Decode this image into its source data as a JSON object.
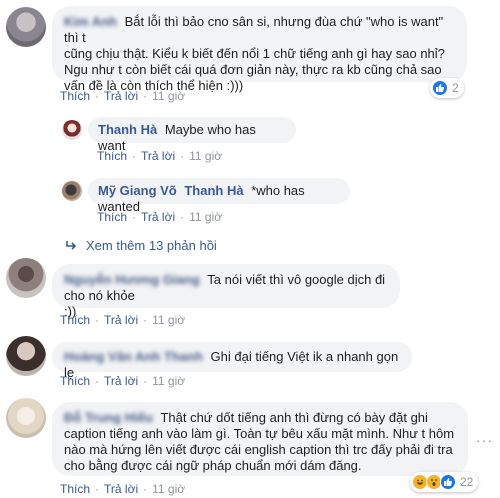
{
  "comments": [
    {
      "author": "Kim Anh",
      "text": "Bắt lỗi thì bảo cno sân si, nhưng đùa chứ \"who is want\" thì t cũng chịu thật. Kiểu k biết đến nổi 1 chữ tiếng anh gì hay sao nhỉ? Ngu như t còn biết cái quá đơn giản này, thực ra kb cũng chả sao vấn đề là còn thích thể hiện :)))",
      "lines": [
        "Bắt lỗi thì bảo cno sân si, nhưng đùa chứ \"who is want\" thì t",
        "cũng chịu thật. Kiểu k biết đến nổi 1 chữ tiếng anh gì hay sao nhỉ?",
        "Ngu như t còn biết cái quá đơn giản này, thực ra kb cũng chả sao",
        "vấn đề là còn thích thể hiện :)))"
      ],
      "like": "Thích",
      "reply": "Trả lời",
      "time": "11 giờ",
      "reaction_count": "2"
    },
    {
      "author": "Thanh Hà",
      "text": "Maybe who has want",
      "like": "Thích",
      "reply": "Trả lời",
      "time": "11 giờ"
    },
    {
      "author": "Mỹ Giang Võ",
      "mention": "Thanh Hà",
      "text": "*who has wanted",
      "like": "Thích",
      "reply": "Trả lời",
      "time": "11 giờ"
    },
    {
      "author": "Nguyễn Hương Giang",
      "lines": [
        "Ta nói viết thì vô google dịch đi cho nó khỏe",
        ":))"
      ],
      "like": "Thích",
      "reply": "Trả lời",
      "time": "11 giờ"
    },
    {
      "author": "Hoàng Văn Anh Thanh",
      "text": "Ghi đại tiếng Việt ik a nhanh gọn lẹ",
      "like": "Thích",
      "reply": "Trả lời",
      "time": "11 giờ"
    },
    {
      "author": "Đỗ Trung Hiếu",
      "lines": [
        "Thật chứ dốt tiếng anh thì đừng có bày đặt ghi",
        "caption tiếng anh vào làm gì. Toàn tự bêu xấu mặt mình. Như t hôm",
        "nào mà hứng lên viết được cái english caption thì trc đấy phải đi tra",
        "cho bằng được cái ngữ pháp chuẩn mới dám đăng."
      ],
      "like": "Thích",
      "reply": "Trả lời",
      "time": "11 giờ",
      "reaction_count": "22"
    }
  ],
  "view_more_replies": "Xem thêm 13 phản hồi",
  "colors": {
    "link": "#385898",
    "meta": "#90949c",
    "bubble": "#f2f3f5",
    "like_blue": "#1877f2"
  },
  "icons": {
    "like": "thumbs-up-icon",
    "haha": "haha-emoji-icon",
    "wow": "wow-emoji-icon",
    "reply_arrow": "reply-arrow-icon",
    "more": "more-options-icon"
  }
}
